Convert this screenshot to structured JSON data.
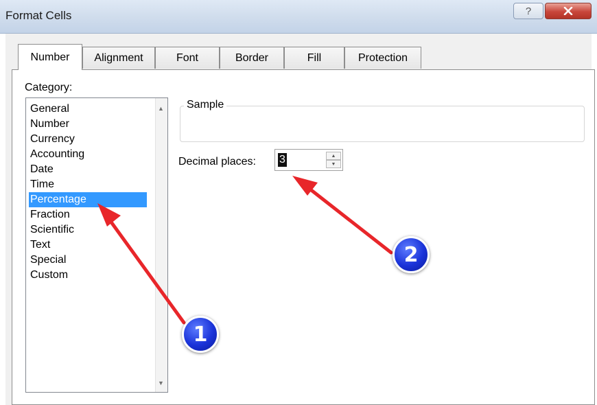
{
  "window": {
    "title": "Format Cells",
    "help_label": "?"
  },
  "tabs": [
    {
      "label": "Number",
      "active": true
    },
    {
      "label": "Alignment",
      "active": false
    },
    {
      "label": "Font",
      "active": false
    },
    {
      "label": "Border",
      "active": false
    },
    {
      "label": "Fill",
      "active": false
    },
    {
      "label": "Protection",
      "active": false
    }
  ],
  "category": {
    "label": "Category:",
    "items": [
      "General",
      "Number",
      "Currency",
      "Accounting",
      "Date",
      "Time",
      "Percentage",
      "Fraction",
      "Scientific",
      "Text",
      "Special",
      "Custom"
    ],
    "selected": "Percentage"
  },
  "sample": {
    "label": "Sample",
    "value": ""
  },
  "decimal_places": {
    "label": "Decimal places:",
    "value": "3"
  },
  "annotations": {
    "badge_1": "1",
    "badge_2": "2",
    "arrow_color": "#e8262a",
    "badge_color": "#1a33d9"
  }
}
